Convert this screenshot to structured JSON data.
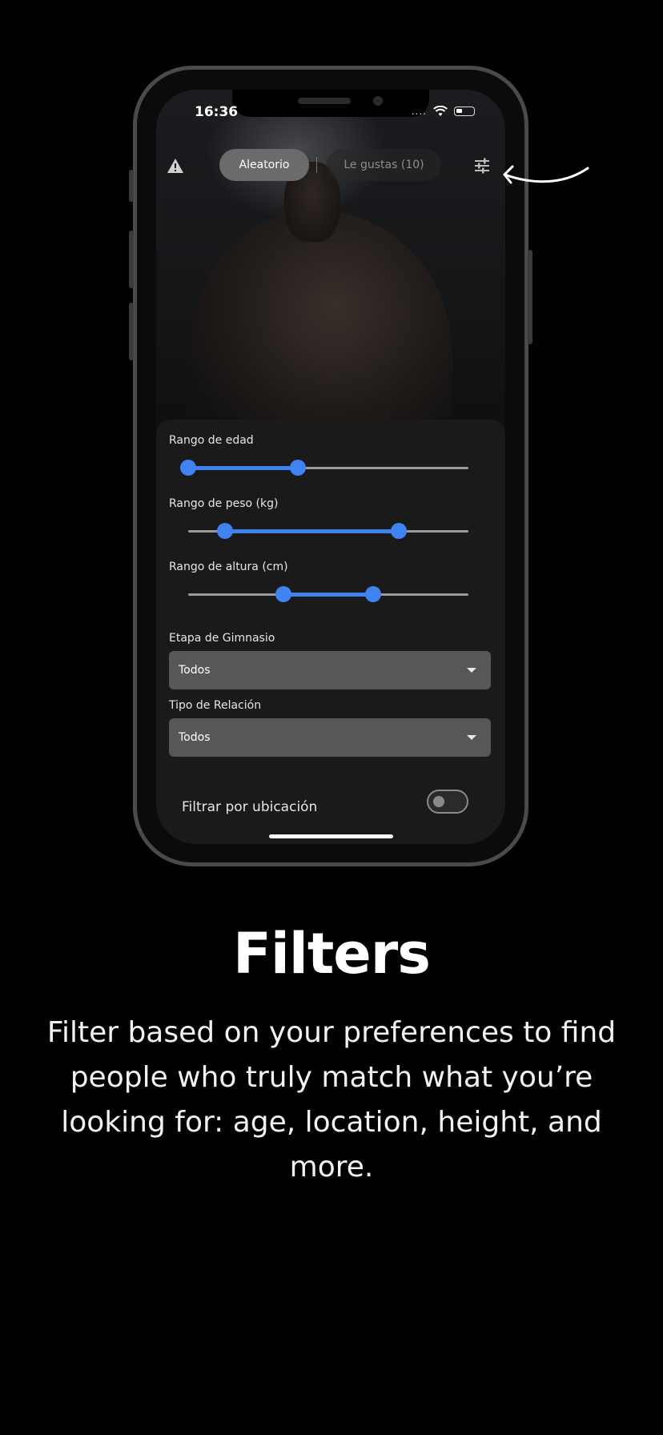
{
  "status_bar": {
    "time": "16:36",
    "signal": "...."
  },
  "top_bar": {
    "tabs": [
      {
        "label": "Aleatorio",
        "active": true
      },
      {
        "label": "Le gustas (10)",
        "active": false
      }
    ],
    "icons": [
      "warning-icon",
      "filter-sliders-icon"
    ]
  },
  "filters": {
    "age": {
      "label": "Rango de edad",
      "range_fraction": [
        0.0,
        0.39
      ]
    },
    "weight": {
      "label": "Rango de peso (kg)",
      "range_fraction": [
        0.13,
        0.75
      ]
    },
    "height": {
      "label": "Rango de altura (cm)",
      "range_fraction": [
        0.34,
        0.66
      ]
    },
    "gym_stage": {
      "label": "Etapa de Gimnasio",
      "value": "Todos"
    },
    "relation_type": {
      "label": "Tipo de Relación",
      "value": "Todos"
    },
    "location": {
      "label": "Filtrar por ubicación",
      "enabled": false
    }
  },
  "colors": {
    "accent": "#3f82f2",
    "background": "#000000",
    "sheet": "#1a1a1a"
  },
  "caption": {
    "title": "Filters",
    "description": "Filter based on your preferences to find people who truly match what you’re looking for: age, location, height, and more."
  }
}
